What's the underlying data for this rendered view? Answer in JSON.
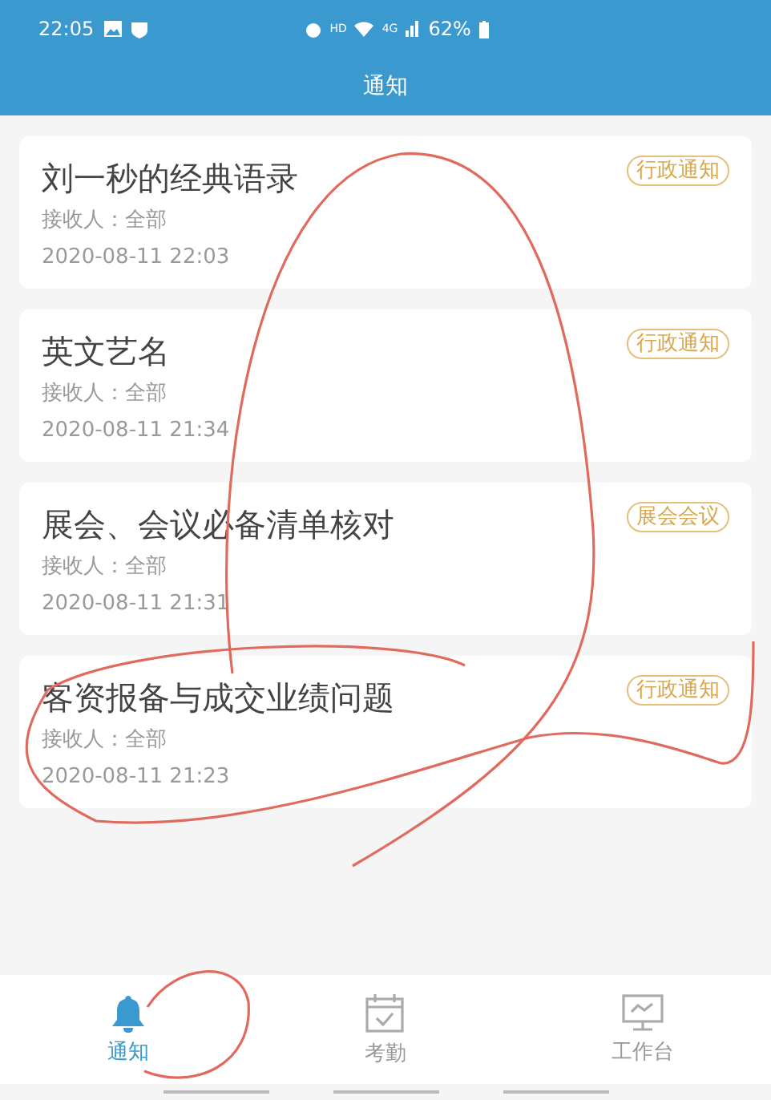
{
  "status_bar": {
    "time": "22:05",
    "hd": "HD",
    "network": "4G",
    "battery": "62%"
  },
  "title": "通知",
  "notices": [
    {
      "title": "刘一秒的经典语录",
      "recipient": "接收人：全部",
      "time": "2020-08-11 22:03",
      "tag": "行政通知"
    },
    {
      "title": "英文艺名",
      "recipient": "接收人：全部",
      "time": "2020-08-11 21:34",
      "tag": "行政通知"
    },
    {
      "title": "展会、会议必备清单核对",
      "recipient": "接收人：全部",
      "time": "2020-08-11 21:31",
      "tag": "展会会议"
    },
    {
      "title": "客资报备与成交业绩问题",
      "recipient": "接收人：全部",
      "time": "2020-08-11 21:23",
      "tag": "行政通知"
    }
  ],
  "tabs": [
    {
      "label": "通知",
      "kind": "bell",
      "selected": true
    },
    {
      "label": "考勤",
      "kind": "calendar",
      "selected": false
    },
    {
      "label": "工作台",
      "kind": "monitor",
      "selected": false
    }
  ]
}
